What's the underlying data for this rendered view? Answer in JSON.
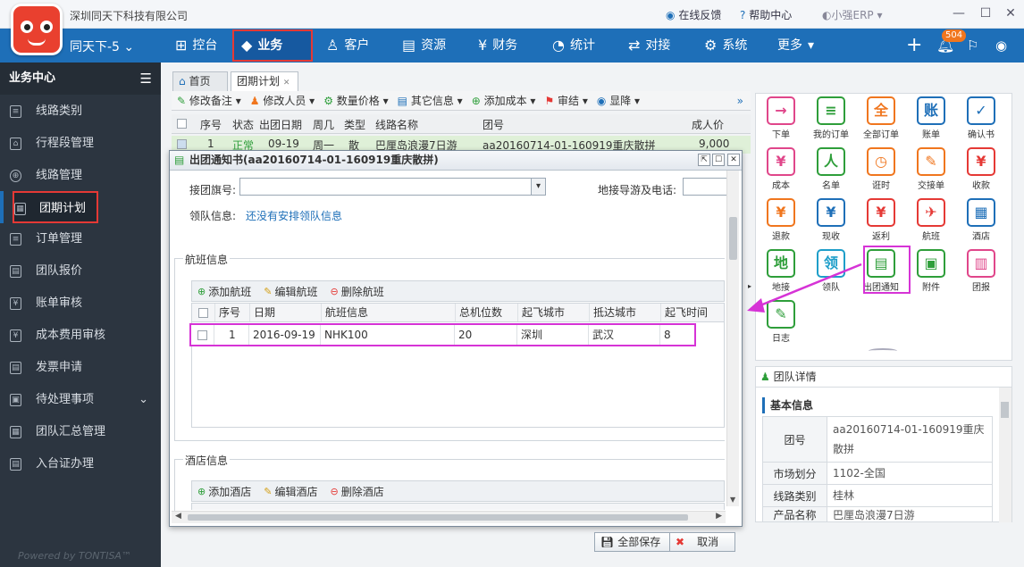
{
  "app": {
    "company": "深圳同天下科技有限公司",
    "user": "同天下-5",
    "feedback": "在线反馈",
    "help": "帮助中心",
    "brand": "小强ERP",
    "notif_count": "504",
    "powered": "Powered by TONTISA™"
  },
  "nav": [
    {
      "label": "控台",
      "icon": "dashboard-icon"
    },
    {
      "label": "业务",
      "icon": "cube-icon"
    },
    {
      "label": "客户",
      "icon": "person-icon"
    },
    {
      "label": "资源",
      "icon": "database-icon"
    },
    {
      "label": "财务",
      "icon": "yen-icon"
    },
    {
      "label": "统计",
      "icon": "chart-icon"
    },
    {
      "label": "对接",
      "icon": "swap-icon"
    },
    {
      "label": "系统",
      "icon": "gear-icon"
    },
    {
      "label": "更多",
      "icon": "chevron-down-icon"
    }
  ],
  "sidebar": {
    "title": "业务中心",
    "items": [
      "线路类别",
      "行程段管理",
      "线路管理",
      "团期计划",
      "订单管理",
      "团队报价",
      "账单审核",
      "成本费用审核",
      "发票申请",
      "待处理事项",
      "团队汇总管理",
      "入台证办理"
    ]
  },
  "tabs": [
    "首页",
    "团期计划"
  ],
  "toolbar": [
    "修改备注",
    "修改人员",
    "数量价格",
    "其它信息",
    "添加成本",
    "审结",
    "显降"
  ],
  "grid": {
    "headers": [
      "序号",
      "状态",
      "出团日期",
      "周几",
      "类型",
      "线路名称",
      "团号",
      "成人价"
    ],
    "row": [
      "1",
      "正常",
      "09-19",
      "周一",
      "散",
      "巴厘岛浪漫7日游",
      "aa20160714-01-160919重庆散拼",
      "9,000"
    ]
  },
  "dialog": {
    "title": "出团通知书(aa20160714-01-160919重庆散拼)",
    "flag_label": "接团旗号:",
    "guide_label": "地接导游及电话:",
    "leader_label": "领队信息:",
    "leader_value": "还没有安排领队信息",
    "flight_section": "航班信息",
    "flight_toolbar": {
      "add": "添加航班",
      "edit": "编辑航班",
      "del": "删除航班"
    },
    "flight_headers": [
      "序号",
      "日期",
      "航班信息",
      "总机位数",
      "起飞城市",
      "抵达城市",
      "起飞时间"
    ],
    "flight_row": [
      "1",
      "2016-09-19",
      "NHK100",
      "20",
      "深圳",
      "武汉",
      "8"
    ],
    "hotel_section": "酒店信息",
    "hotel_toolbar": {
      "add": "添加酒店",
      "edit": "编辑酒店",
      "del": "删除酒店"
    },
    "save_all": "全部保存",
    "cancel": "取消"
  },
  "right_icons": [
    {
      "label": "下单",
      "sym": "→",
      "color": "#e0468a"
    },
    {
      "label": "我的订单",
      "sym": "≡",
      "color": "#2e9e3a"
    },
    {
      "label": "全部订单",
      "sym": "全",
      "color": "#f0761e"
    },
    {
      "label": "账单",
      "sym": "账",
      "color": "#1e6fb8"
    },
    {
      "label": "确认书",
      "sym": "✓",
      "color": "#1e6fb8"
    },
    {
      "label": "成本",
      "sym": "¥",
      "color": "#e0468a"
    },
    {
      "label": "名单",
      "sym": "人",
      "color": "#2e9e3a"
    },
    {
      "label": "诳时",
      "sym": "◷",
      "color": "#f0761e"
    },
    {
      "label": "交接单",
      "sym": "✎",
      "color": "#f0761e"
    },
    {
      "label": "收款",
      "sym": "¥",
      "color": "#e53935"
    },
    {
      "label": "退款",
      "sym": "¥",
      "color": "#f0761e"
    },
    {
      "label": "现收",
      "sym": "¥",
      "color": "#1e6fb8"
    },
    {
      "label": "返利",
      "sym": "¥",
      "color": "#e53935"
    },
    {
      "label": "航班",
      "sym": "✈",
      "color": "#e53935"
    },
    {
      "label": "酒店",
      "sym": "▦",
      "color": "#1e6fb8"
    },
    {
      "label": "地接",
      "sym": "地",
      "color": "#2e9e3a"
    },
    {
      "label": "领队",
      "sym": "领",
      "color": "#1e9ec9"
    },
    {
      "label": "出团通知",
      "sym": "▤",
      "color": "#2e9e3a"
    },
    {
      "label": "附件",
      "sym": "▣",
      "color": "#2e9e3a"
    },
    {
      "label": "团报",
      "sym": "▥",
      "color": "#e0468a"
    },
    {
      "label": "日志",
      "sym": "✎",
      "color": "#2e9e3a"
    }
  ],
  "detail": {
    "title": "团队详情",
    "section": "基本信息",
    "rows": [
      {
        "k": "团号",
        "v": "aa20160714-01-160919重庆散拼"
      },
      {
        "k": "市场划分",
        "v": "1102-全国"
      },
      {
        "k": "线路类别",
        "v": "桂林"
      },
      {
        "k": "产品名称",
        "v": "巴厘岛浪漫7日游"
      }
    ]
  }
}
